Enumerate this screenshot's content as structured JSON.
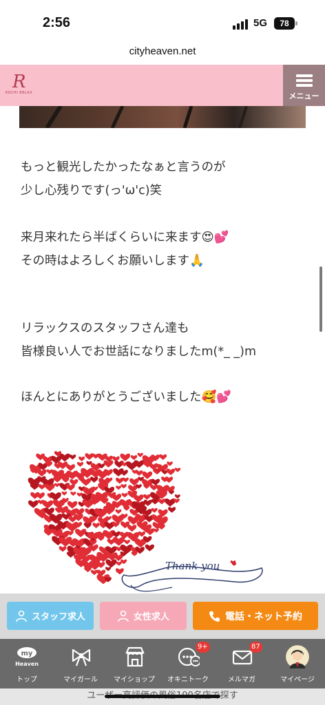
{
  "status_bar": {
    "time": "2:56",
    "network": "5G",
    "battery": "78"
  },
  "browser": {
    "url": "cityheaven.net"
  },
  "header": {
    "logo_mark": "R",
    "logo_text": "KOCHI RELAX",
    "menu_label": "メニュー"
  },
  "post": {
    "lines": [
      "もっと観光したかったなぁと言うのが",
      "少し心残りです(っ'ω'c)笑",
      "来月来れたら半ばくらいに来ます😍💕",
      "その時はよろしくお願いします🙏",
      "リラックスのスタッフさん達も",
      "皆様良い人でお世話になりましたm(*_ _)m",
      "ほんとにありがとうございました🥰💕"
    ],
    "image_caption": "Thank you"
  },
  "action_bar": {
    "staff_label": "スタッフ求人",
    "female_label": "女性求人",
    "tel_label": "電話・ネット予約"
  },
  "tab_bar": {
    "items": [
      {
        "label": "トップ",
        "icon": "my-heaven-icon",
        "logo_top": "my",
        "logo_bottom": "Heaven"
      },
      {
        "label": "マイガール",
        "icon": "ribbon-icon"
      },
      {
        "label": "マイショップ",
        "icon": "shop-icon"
      },
      {
        "label": "オキニトーク",
        "icon": "chat-icon",
        "badge": "9+"
      },
      {
        "label": "メルマガ",
        "icon": "mail-icon",
        "badge": "87"
      },
      {
        "label": "マイページ",
        "icon": "avatar-icon"
      }
    ]
  },
  "footer": {
    "text": "ユーザー高評価の風俗100名店で探す"
  },
  "colors": {
    "header_pink": "#f9bfcb",
    "menu_bg": "#9c7f82",
    "staff": "#72c6ec",
    "female": "#f7a8b7",
    "tel": "#f48a14",
    "tabbar": "#6a6a6a"
  }
}
